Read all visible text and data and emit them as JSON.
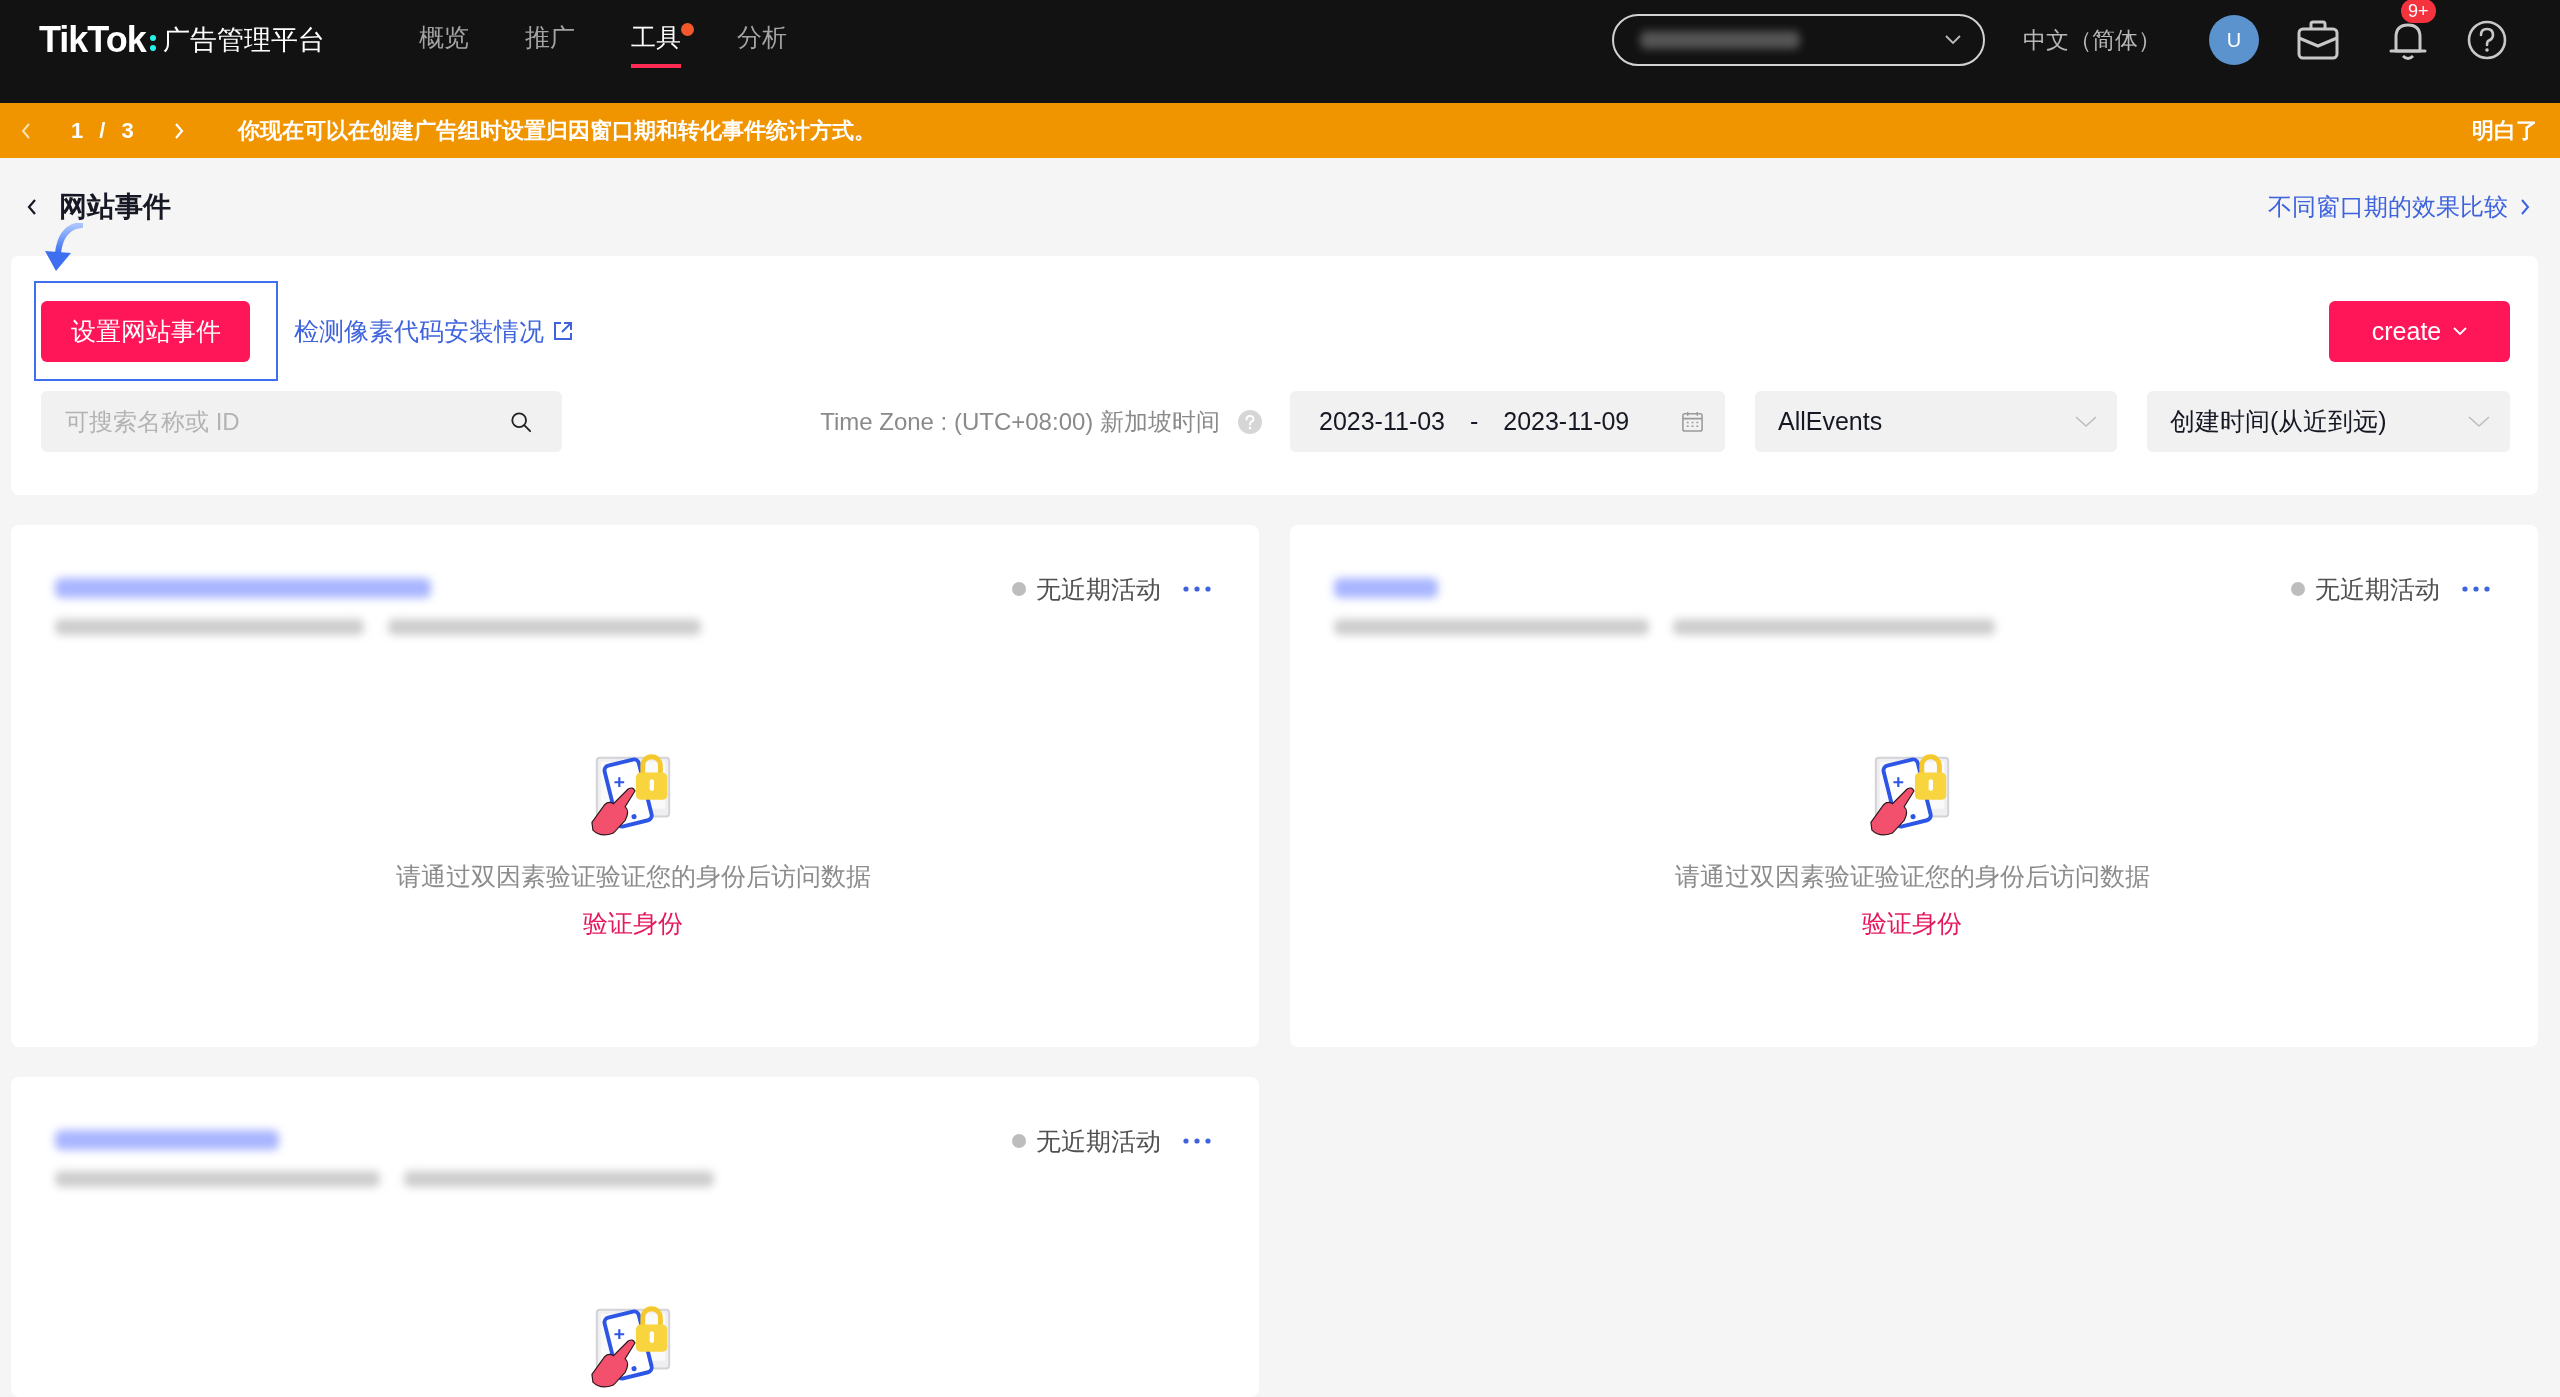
{
  "header": {
    "brand": "TikTok",
    "product": "广告管理平台",
    "nav": [
      {
        "label": "概览",
        "selected": false,
        "dot": false
      },
      {
        "label": "推广",
        "selected": false,
        "dot": false
      },
      {
        "label": "工具",
        "selected": true,
        "dot": true
      },
      {
        "label": "分析",
        "selected": false,
        "dot": false
      }
    ],
    "language": "中文（简体）",
    "avatar": "U",
    "notifications": "9+"
  },
  "banner": {
    "pager": "1 / 3",
    "message": "你现在可以在创建广告组时设置归因窗口期和转化事件统计方式。",
    "dismiss": "明白了"
  },
  "page": {
    "title": "网站事件",
    "compare_link": "不同窗口期的效果比较"
  },
  "toolbar": {
    "setup_button": {
      "label": "设置网站事件",
      "highlighted": true
    },
    "check_link": "检测像素代码安装情况",
    "create_button": "create",
    "search": {
      "placeholder": "可搜索名称或 ID"
    },
    "time_zone": "Time Zone : (UTC+08:00) 新加坡时间",
    "date_range": {
      "start": "2023-11-03",
      "separator": "-",
      "end": "2023-11-09"
    },
    "event_filter": "AllEvents",
    "sort": "创建时间(从近到远)"
  },
  "pixels": [
    {
      "status": "无近期活动",
      "message": "请通过双因素验证验证您的身份后访问数据",
      "action": "验证身份"
    },
    {
      "status": "无近期活动",
      "message": "请通过双因素验证验证您的身份后访问数据",
      "action": "验证身份"
    },
    {
      "status": "无近期活动"
    }
  ]
}
